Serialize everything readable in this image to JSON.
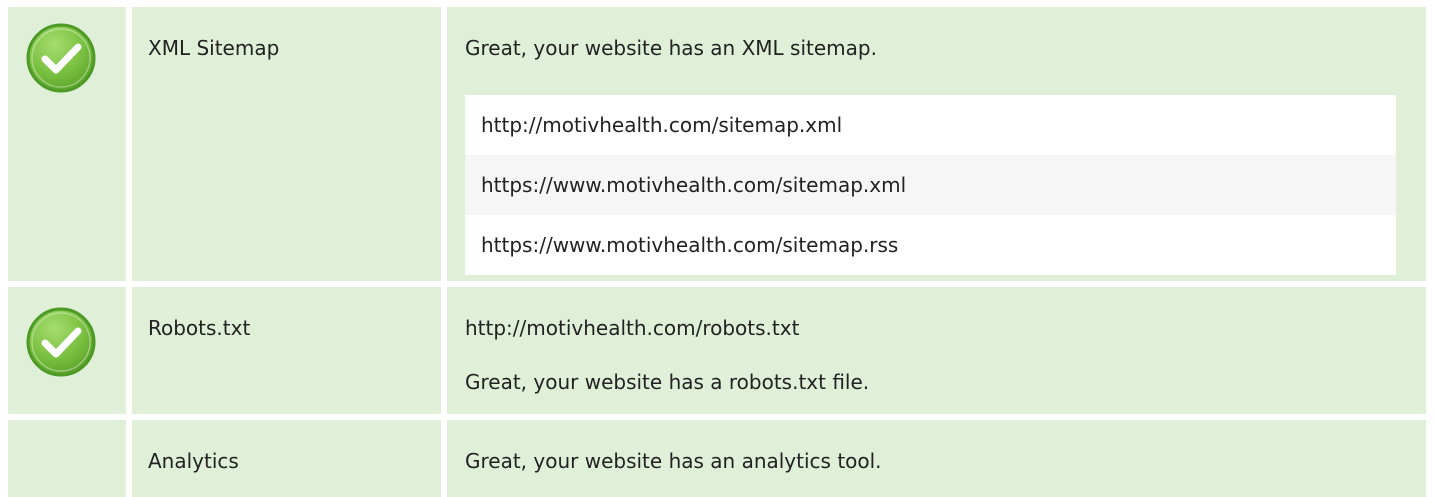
{
  "colors": {
    "row_bg": "#dfefd8",
    "check_green": "#7cc242",
    "check_border": "#4e9a27",
    "url_bg": "#ffffff",
    "url_alt_bg": "#f6f6f6"
  },
  "rows": {
    "sitemap": {
      "status_icon": "check-circle-icon",
      "name": "XML Sitemap",
      "message": "Great, your website has an XML sitemap.",
      "urls": [
        "http://motivhealth.com/sitemap.xml",
        "https://www.motivhealth.com/sitemap.xml",
        "https://www.motivhealth.com/sitemap.rss"
      ]
    },
    "robots": {
      "status_icon": "check-circle-icon",
      "name": "Robots.txt",
      "url": "http://motivhealth.com/robots.txt",
      "message": "Great, your website has a robots.txt file."
    },
    "analytics": {
      "name": "Analytics",
      "message": "Great, your website has an analytics tool."
    }
  }
}
